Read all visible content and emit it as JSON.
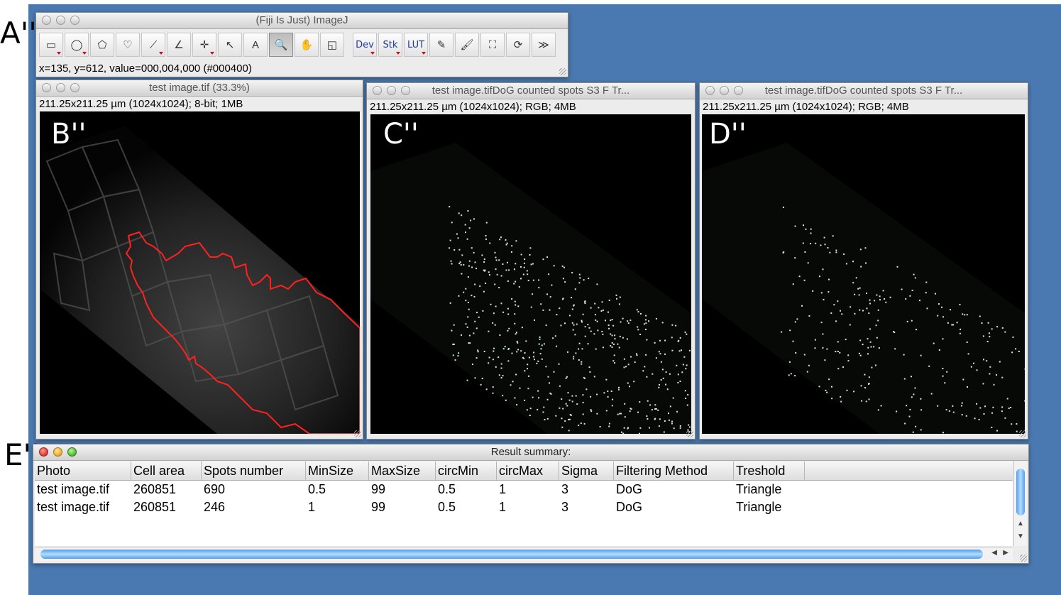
{
  "panel_labels": {
    "a": "A''",
    "e": "E''"
  },
  "toolbar_window": {
    "title": "(Fiji Is Just) ImageJ",
    "status": "x=135, y=612, value=000,004,000 (#000400)",
    "tools": [
      {
        "name": "rectangle-tool",
        "glyph": "▭"
      },
      {
        "name": "oval-tool",
        "glyph": "◯"
      },
      {
        "name": "polygon-tool",
        "glyph": "⬠"
      },
      {
        "name": "freehand-tool",
        "glyph": "♡"
      },
      {
        "name": "line-tool",
        "glyph": "⟋"
      },
      {
        "name": "angle-tool",
        "glyph": "∠"
      },
      {
        "name": "point-tool",
        "glyph": "✛"
      },
      {
        "name": "wand-tool",
        "glyph": "↖"
      },
      {
        "name": "text-tool",
        "glyph": "A"
      },
      {
        "name": "magnifier-tool",
        "glyph": "🔍"
      },
      {
        "name": "hand-tool",
        "glyph": "✋"
      },
      {
        "name": "color-picker-tool",
        "glyph": "◱"
      }
    ],
    "menus": [
      {
        "name": "dev-menu",
        "label": "Dev"
      },
      {
        "name": "stk-menu",
        "label": "Stk"
      },
      {
        "name": "lut-menu",
        "label": "LUT"
      }
    ],
    "extra_tools": [
      {
        "name": "pencil-tool",
        "glyph": "✎"
      },
      {
        "name": "brush-tool",
        "glyph": "🖌"
      },
      {
        "name": "flood-fill-tool",
        "glyph": "⛶"
      },
      {
        "name": "refresh-tool",
        "glyph": "⟳"
      },
      {
        "name": "more-tools",
        "glyph": "≫"
      }
    ]
  },
  "image_windows": [
    {
      "title": "test image.tif (33.3%)",
      "info": "211.25x211.25 µm (1024x1024); 8-bit; 1MB",
      "label": "B''"
    },
    {
      "title": "test image.tifDoG counted spots S3 F Tr...",
      "info": "211.25x211.25 µm (1024x1024); RGB; 4MB",
      "label": "C''"
    },
    {
      "title": "test image.tifDoG counted spots S3 F Tr...",
      "info": "211.25x211.25 µm (1024x1024); RGB; 4MB",
      "label": "D''"
    }
  ],
  "results": {
    "title": "Result summary:",
    "columns": [
      "Photo",
      "Cell area",
      "Spots number",
      "MinSize",
      "MaxSize",
      "circMin",
      "circMax",
      "Sigma",
      "Filtering Method",
      "Treshold"
    ],
    "rows": [
      [
        "test image.tif",
        "260851",
        "690",
        "0.5",
        "99",
        "0.5",
        "1",
        "3",
        "DoG",
        "Triangle"
      ],
      [
        "test image.tif",
        "260851",
        "246",
        "1",
        "99",
        "0.5",
        "1",
        "3",
        "DoG",
        "Triangle"
      ]
    ]
  },
  "colors": {
    "desktop": "#4a79b1",
    "roi_outline": "#ff2020",
    "spot": "#cfe8d8"
  }
}
